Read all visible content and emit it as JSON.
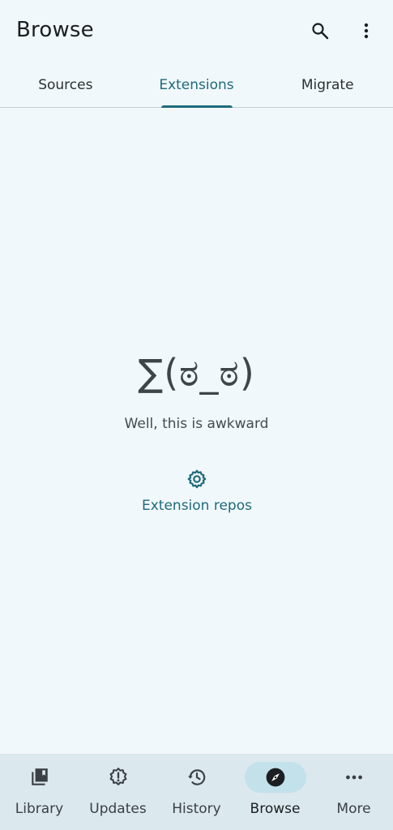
{
  "header": {
    "title": "Browse",
    "search_icon": "search-icon",
    "overflow_icon": "more-vert-icon"
  },
  "tabs": [
    {
      "label": "Sources",
      "active": false
    },
    {
      "label": "Extensions",
      "active": true
    },
    {
      "label": "Migrate",
      "active": false
    }
  ],
  "empty_state": {
    "face": "∑(ಠ_ಠ)",
    "message": "Well, this is awkward",
    "action_icon": "gear-icon",
    "action_label": "Extension repos"
  },
  "bottom_nav": {
    "items": [
      {
        "label": "Library",
        "icon": "library-icon",
        "active": false
      },
      {
        "label": "Updates",
        "icon": "updates-icon",
        "active": false
      },
      {
        "label": "History",
        "icon": "history-icon",
        "active": false
      },
      {
        "label": "Browse",
        "icon": "explore-icon",
        "active": true
      },
      {
        "label": "More",
        "icon": "more-horiz-icon",
        "active": false
      }
    ]
  },
  "colors": {
    "background": "#f1f8fb",
    "accent": "#1e6a7c",
    "nav_background": "#dbe8ee",
    "active_pill": "#c3e1eb"
  }
}
